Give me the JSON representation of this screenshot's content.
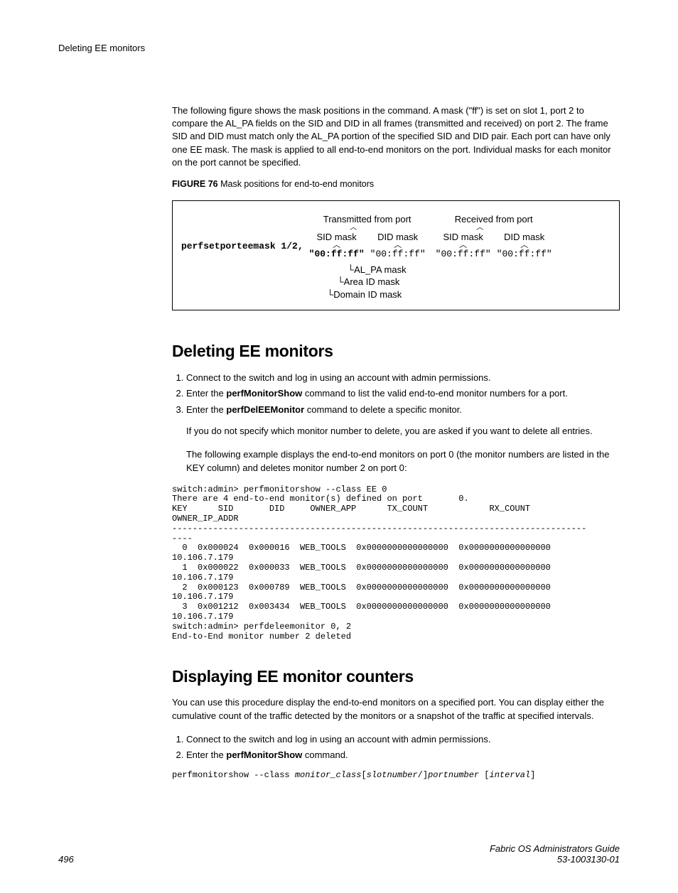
{
  "header": {
    "running": "Deleting EE monitors"
  },
  "intro": {
    "para": "The following figure shows the mask positions in the command. A mask (\"ff\") is set on slot 1, port 2 to compare the AL_PA fields on the SID and DID in all frames (transmitted and received) on port 2. The frame SID and DID must match only the AL_PA portion of the specified SID and DID pair. Each port can have only one EE mask. The mask is applied to all end-to-end monitors on the port. Individual masks for each monitor on the port cannot be specified."
  },
  "figure": {
    "label": "FIGURE 76",
    "caption": "Mask positions for end-to-end monitors",
    "cmd": "perfsetporteemask 1/2,",
    "tx_title": "Transmitted from port",
    "rx_title": "Received from port",
    "sid_label": "SID mask",
    "did_label": "DID mask",
    "mask": "\"00:ff:ff\"",
    "annot1": "AL_PA mask",
    "annot2": "Area ID mask",
    "annot3": "Domain ID mask"
  },
  "section1": {
    "heading": "Deleting EE monitors",
    "steps": {
      "s1": "Connect to the switch and log in using an account with admin permissions.",
      "s2_pre": "Enter the ",
      "s2_cmd": "perfMonitorShow",
      "s2_post": " command to list the valid end-to-end monitor numbers for a port.",
      "s3_pre": "Enter the ",
      "s3_cmd": "perfDelEEMonitor",
      "s3_post": " command to delete a specific monitor."
    },
    "note": "If you do not specify which monitor number to delete, you are asked if you want to delete all entries.",
    "example_intro": "The following example displays the end-to-end monitors on port 0 (the monitor numbers are listed in the KEY column) and deletes monitor number 2 on port 0:",
    "code": "switch:admin> perfmonitorshow --class EE 0\nThere are 4 end-to-end monitor(s) defined on port       0.\nKEY      SID       DID     OWNER_APP      TX_COUNT            RX_COUNT          \nOWNER_IP_ADDR\n---------------------------------------------------------------------------------\n----\n  0  0x000024  0x000016  WEB_TOOLS  0x0000000000000000  0x0000000000000000  \n10.106.7.179\n  1  0x000022  0x000033  WEB_TOOLS  0x0000000000000000  0x0000000000000000  \n10.106.7.179\n  2  0x000123  0x000789  WEB_TOOLS  0x0000000000000000  0x0000000000000000  \n10.106.7.179\n  3  0x001212  0x003434  WEB_TOOLS  0x0000000000000000  0x0000000000000000  \n10.106.7.179\nswitch:admin> perfdeleemonitor 0, 2\nEnd-to-End monitor number 2 deleted"
  },
  "section2": {
    "heading": "Displaying EE monitor counters",
    "para": "You can use this procedure display the end-to-end monitors on a specified port. You can display either the cumulative count of the traffic detected by the monitors or a snapshot of the traffic at specified intervals.",
    "steps": {
      "s1": "Connect to the switch and log in using an account with admin permissions.",
      "s2_pre": "Enter the ",
      "s2_cmd": "perfMonitorShow",
      "s2_post": " command."
    },
    "syntax_pre": "perfmonitorshow --class ",
    "syntax_i1": "monitor_class",
    "syntax_b1": "[",
    "syntax_i2": "slotnumber",
    "syntax_b2": "/]",
    "syntax_i3": "portnumber",
    "syntax_b3": " [",
    "syntax_i4": "interval",
    "syntax_b4": "]"
  },
  "footer": {
    "page": "496",
    "title": "Fabric OS Administrators Guide",
    "docnum": "53-1003130-01"
  }
}
